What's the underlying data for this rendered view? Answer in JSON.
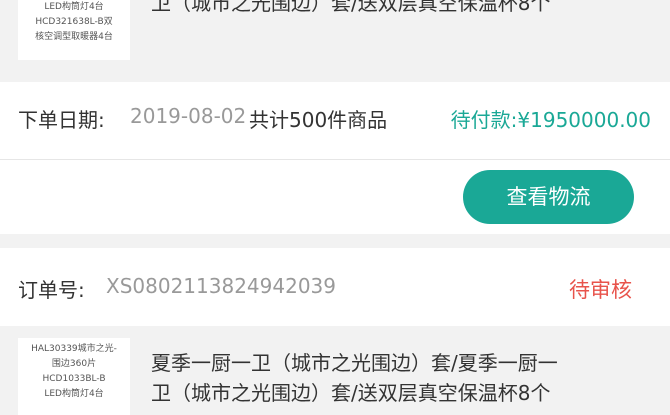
{
  "orders": [
    {
      "product": {
        "thumb_lines": [
          "LED构筒灯4台",
          "HCD321638L-B双",
          "核空调型取暖器4台"
        ],
        "title_lines": [
          "卫（城市之光围边）套/送双层真空保温杯8个"
        ]
      },
      "summary": {
        "date_label": "下单日期:",
        "date": "2019-08-02",
        "count_text": "共计500件商品",
        "status_amount": "待付款:¥1950000.00"
      },
      "actions": {
        "logistics_label": "查看物流"
      }
    },
    {
      "header": {
        "number_label": "订单号:",
        "number": "XS0802113824942039",
        "status": "待审核"
      },
      "product": {
        "thumb_lines": [
          "HAL30339城市之光-",
          "围边360片",
          "HCD1033BL-B",
          "LED构筒灯4台"
        ],
        "title_lines": [
          "夏季一厨一卫（城市之光围边）套/夏季一厨一",
          "卫（城市之光围边）套/送双层真空保温杯8个"
        ]
      }
    }
  ],
  "colors": {
    "accent": "#1aa896",
    "pending_review": "#e8534b",
    "muted_text": "#999999",
    "background": "#f2f2f2"
  }
}
